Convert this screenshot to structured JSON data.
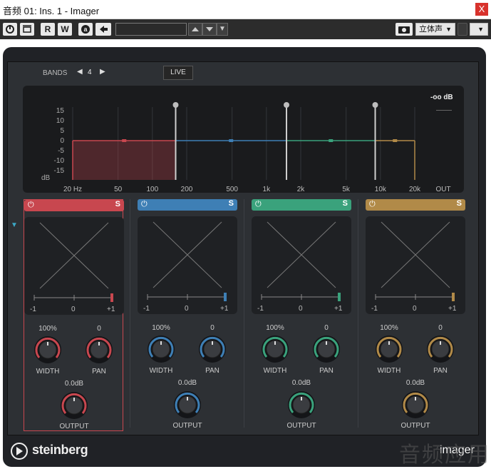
{
  "window": {
    "title": "音频 01: Ins. 1 - Imager",
    "close_label": "X"
  },
  "toolbar": {
    "power_icon": "power-icon",
    "bypass_icon": "bypass-icon",
    "read_label": "R",
    "write_label": "W",
    "preset_value": "",
    "channel_select": "立体声",
    "snapshot_icon": "camera-icon",
    "dropdown_label": "▼"
  },
  "header": {
    "bands_label": "BANDS",
    "bands_value": "4",
    "live_label": "LIVE"
  },
  "spectrum": {
    "out_level": "-oo dB",
    "y_ticks": [
      "15",
      "10",
      "5",
      "0",
      "-5",
      "-10",
      "-15"
    ],
    "y_unit": "dB",
    "x_ticks": [
      "20 Hz",
      "50",
      "100",
      "200",
      "500",
      "1k",
      "2k",
      "5k",
      "10k",
      "20k"
    ],
    "out_label": "OUT",
    "crossover_hz": [
      160,
      1500,
      9000
    ]
  },
  "bands": [
    {
      "name": "band-1",
      "color": "#c8474f",
      "width_label": "WIDTH",
      "width_value": "100%",
      "pan_label": "PAN",
      "pan_value": "0",
      "output_label": "OUTPUT",
      "output_value": "0.0dB",
      "scale_min": "-1",
      "scale_mid": "0",
      "scale_max": "+1",
      "solo_label": "S"
    },
    {
      "name": "band-2",
      "color": "#3e7fb5",
      "width_label": "WIDTH",
      "width_value": "100%",
      "pan_label": "PAN",
      "pan_value": "0",
      "output_label": "OUTPUT",
      "output_value": "0.0dB",
      "scale_min": "-1",
      "scale_mid": "0",
      "scale_max": "+1",
      "solo_label": "S"
    },
    {
      "name": "band-3",
      "color": "#3aa27c",
      "width_label": "WIDTH",
      "width_value": "100%",
      "pan_label": "PAN",
      "pan_value": "0",
      "output_label": "OUTPUT",
      "output_value": "0.0dB",
      "scale_min": "-1",
      "scale_mid": "0",
      "scale_max": "+1",
      "solo_label": "S"
    },
    {
      "name": "band-4",
      "color": "#b18a48",
      "width_label": "WIDTH",
      "width_value": "100%",
      "pan_label": "PAN",
      "pan_value": "0",
      "output_label": "OUTPUT",
      "output_value": "0.0dB",
      "scale_min": "-1",
      "scale_mid": "0",
      "scale_max": "+1",
      "solo_label": "S"
    }
  ],
  "footer": {
    "brand": "steinberg",
    "product": "imager",
    "watermark": "音频应用"
  }
}
